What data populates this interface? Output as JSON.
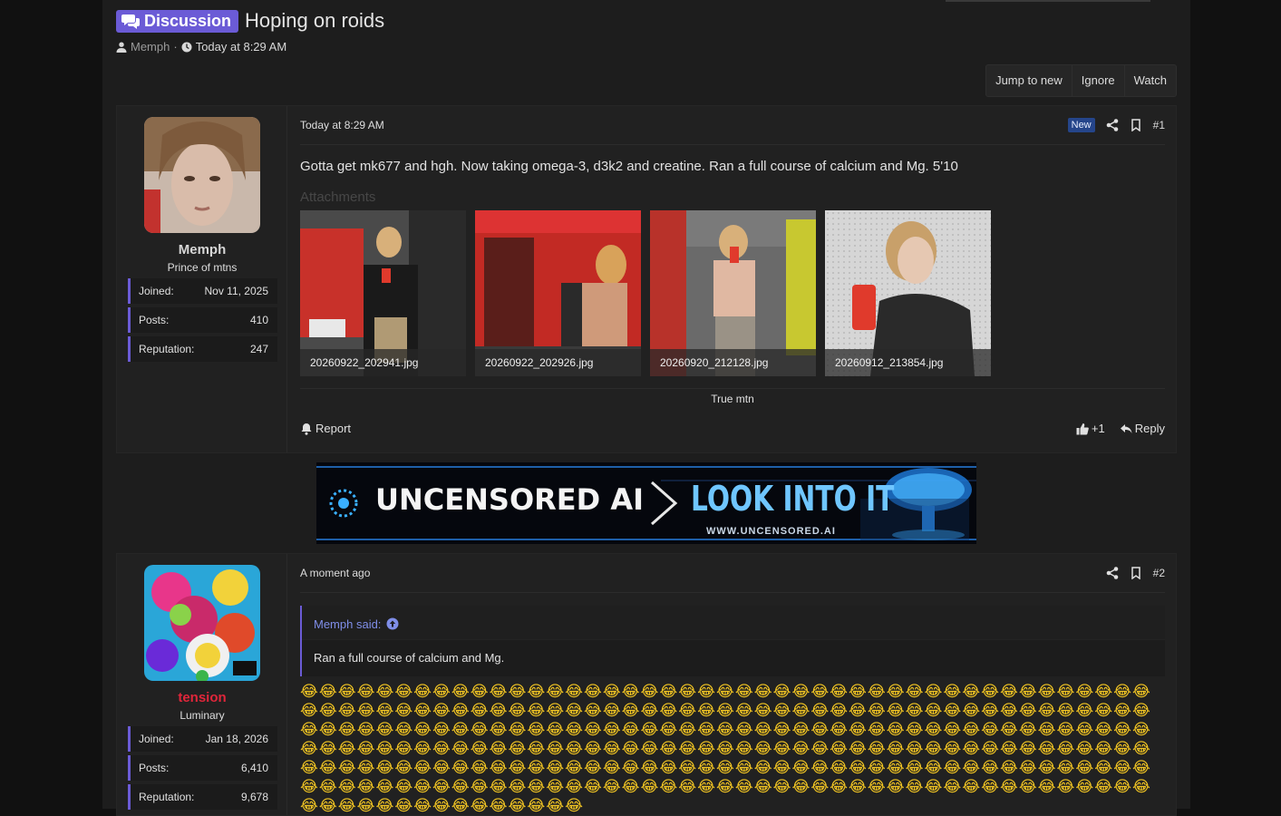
{
  "thread": {
    "prefix": "Discussion",
    "title": "Hoping on roids",
    "author": "Memph",
    "separator": "·",
    "time": "Today at 8:29 AM"
  },
  "actions": {
    "jump": "Jump to new",
    "ignore": "Ignore",
    "watch": "Watch"
  },
  "posts": [
    {
      "user": {
        "name": "Memph",
        "title": "Prince of mtns",
        "name_color": "#9a9a9a",
        "stats": [
          {
            "label": "Joined:",
            "value": "Nov 11, 2025"
          },
          {
            "label": "Posts:",
            "value": "410"
          },
          {
            "label": "Reputation:",
            "value": "247"
          }
        ]
      },
      "time": "Today at 8:29 AM",
      "badge": "New",
      "number": "#1",
      "body": "Gotta get mk677 and hgh. Now taking omega-3, d3k2 and creatine. Ran a full course of calcium and Mg. 5'10",
      "attachments_label": "Attachments",
      "attachments": [
        "20260922_202941.jpg",
        "20260922_202926.jpg",
        "20260920_212128.jpg",
        "20260912_213854.jpg"
      ],
      "signature": "True mtn",
      "report": "Report",
      "reaction_count": "+1",
      "reply": "Reply"
    },
    {
      "user": {
        "name": "tension",
        "title": "Luminary",
        "name_color": "#e0263a",
        "stats": [
          {
            "label": "Joined:",
            "value": "Jan 18, 2026"
          },
          {
            "label": "Posts:",
            "value": "6,410"
          },
          {
            "label": "Reputation:",
            "value": "9,678"
          }
        ]
      },
      "time": "A moment ago",
      "number": "#2",
      "quote_author": "Memph said:",
      "quote_text": "Ran a full course of calcium and Mg.",
      "emoji": "😂😂😂😂😂😂😂😂😂😂😂😂😂😂😂😂😂😂😂😂😂😂😂😂😂😂😂😂😂😂😂😂😂😂😂😂😂😂😂😂😂😂😂😂😂😂😂😂😂😂😂😂😂😂😂😂😂😂😂😂😂😂😂😂😂😂😂😂😂😂😂😂😂😂😂😂😂😂😂😂😂😂😂😂😂😂😂😂😂😂😂😂😂😂😂😂😂😂😂😂😂😂😂😂😂😂😂😂😂😂😂😂😂😂😂😂😂😂😂😂😂😂😂😂😂😂😂😂😂😂😂😂😂😂😂😂😂😂😂😂😂😂😂😂😂😂😂😂😂😂😂😂😂😂😂😂😂😂😂😂😂😂😂😂😂😂😂😂😂😂😂😂😂😂😂😂😂😂😂😂😂😂😂😂😂😂😂😂😂😂😂😂😂😂😂😂😂😂😂😂😂😂😂😂😂😂😂😂😂😂😂😂😂😂😂😂😂😂😂😂😂😂😂😂😂😂😂😂😂😂😂😂😂😂😂😂😂😂😂😂😂😂😂😂😂😂😂😂😂😂😂😂😂😂😂😂😂😂😂😂😂😂😂😂😂😂😂😂😂😂😂😂😂😂😂😂😂😂😂😂😂😂😂😂😂"
    }
  ],
  "banner": {
    "left_text": "UNCENSORED AI",
    "right_text": "LOOK INTO IT",
    "url": "WWW.UNCENSORED.AI"
  },
  "colors": {
    "accent": "#6b5bd6",
    "background": "#1d1d1d",
    "post_bg": "#212121",
    "badge_bg": "#25458a"
  }
}
